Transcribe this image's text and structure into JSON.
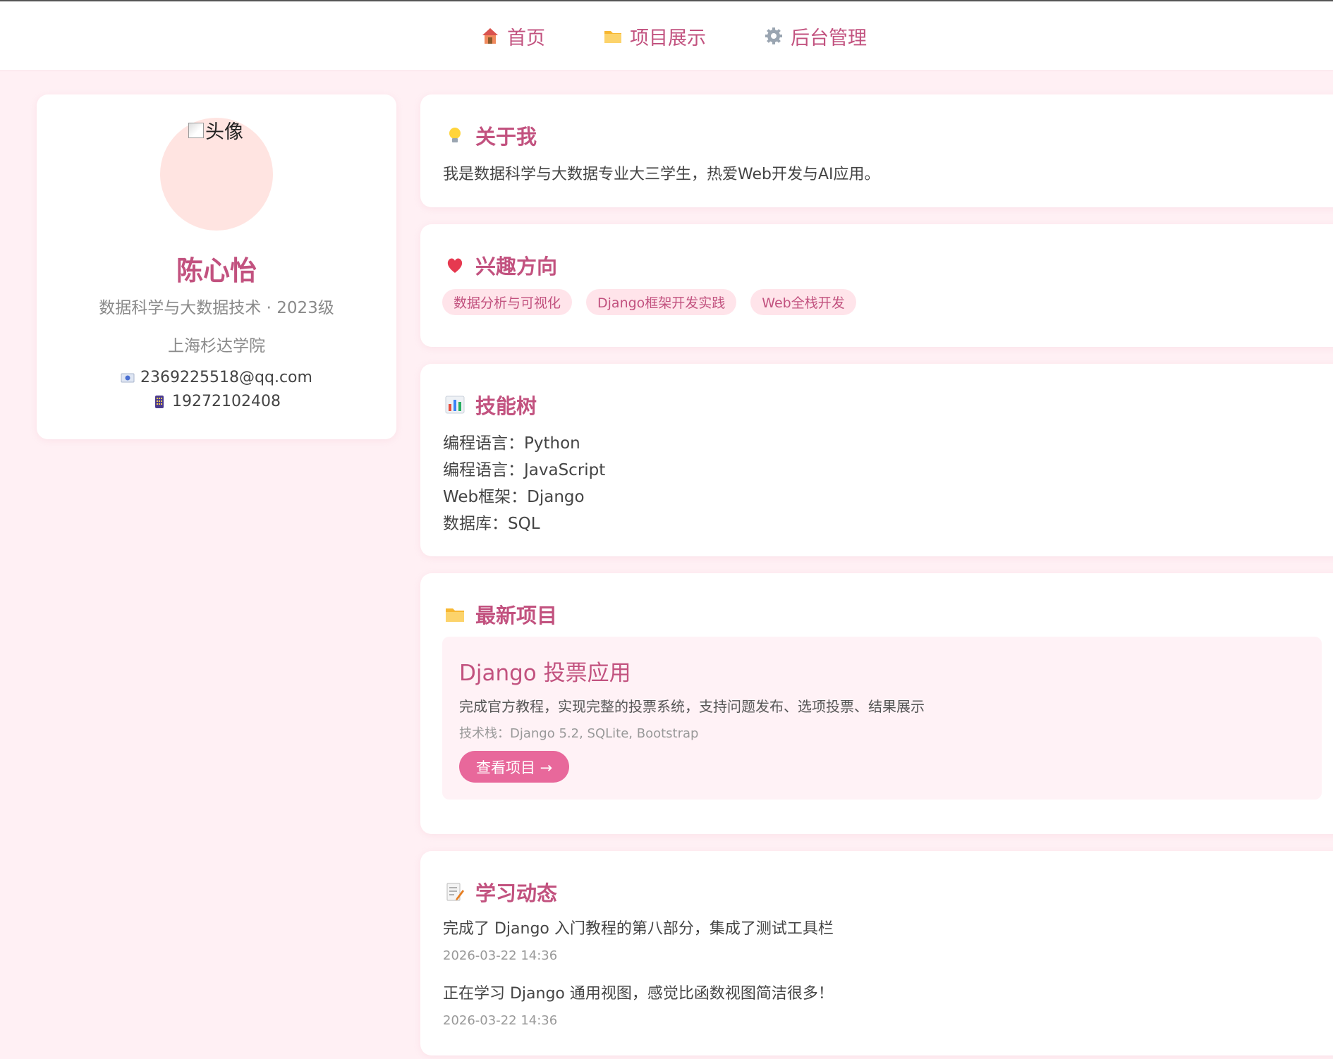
{
  "nav": {
    "items": [
      {
        "label": "首页",
        "icon": "house-icon"
      },
      {
        "label": "项目展示",
        "icon": "folder-icon"
      },
      {
        "label": "后台管理",
        "icon": "gear-icon"
      }
    ]
  },
  "profile": {
    "avatar_alt": "头像",
    "name": "陈心怡",
    "major": "数据科学与大数据技术 · 2023级",
    "school": "上海杉达学院",
    "email": "2369225518@qq.com",
    "phone": "19272102408"
  },
  "about": {
    "title": "关于我",
    "text": "我是数据科学与大数据专业大三学生，热爱Web开发与AI应用。"
  },
  "interests": {
    "title": "兴趣方向",
    "tags": [
      "数据分析与可视化",
      "Django框架开发实践",
      "Web全栈开发"
    ]
  },
  "skills": {
    "title": "技能树",
    "items": [
      "编程语言：Python",
      "编程语言：JavaScript",
      "Web框架：Django",
      "数据库：SQL"
    ]
  },
  "projects": {
    "title": "最新项目",
    "items": [
      {
        "title": "Django 投票应用",
        "desc": "完成官方教程，实现完整的投票系统，支持问题发布、选项投票、结果展示",
        "stack": "技术栈：Django 5.2, SQLite, Bootstrap",
        "button": "查看项目 →"
      }
    ]
  },
  "updates": {
    "title": "学习动态",
    "items": [
      {
        "text": "完成了 Django 入门教程的第八部分，集成了测试工具栏",
        "time": "2026-03-22 14:36"
      },
      {
        "text": "正在学习 Django 通用视图，感觉比函数视图简洁很多！",
        "time": "2026-03-22 14:36"
      }
    ]
  },
  "colors": {
    "accent": "#c2527f",
    "button": "#e8689b",
    "background": "#fff0f4",
    "tag_bg": "#ffe4ea"
  }
}
